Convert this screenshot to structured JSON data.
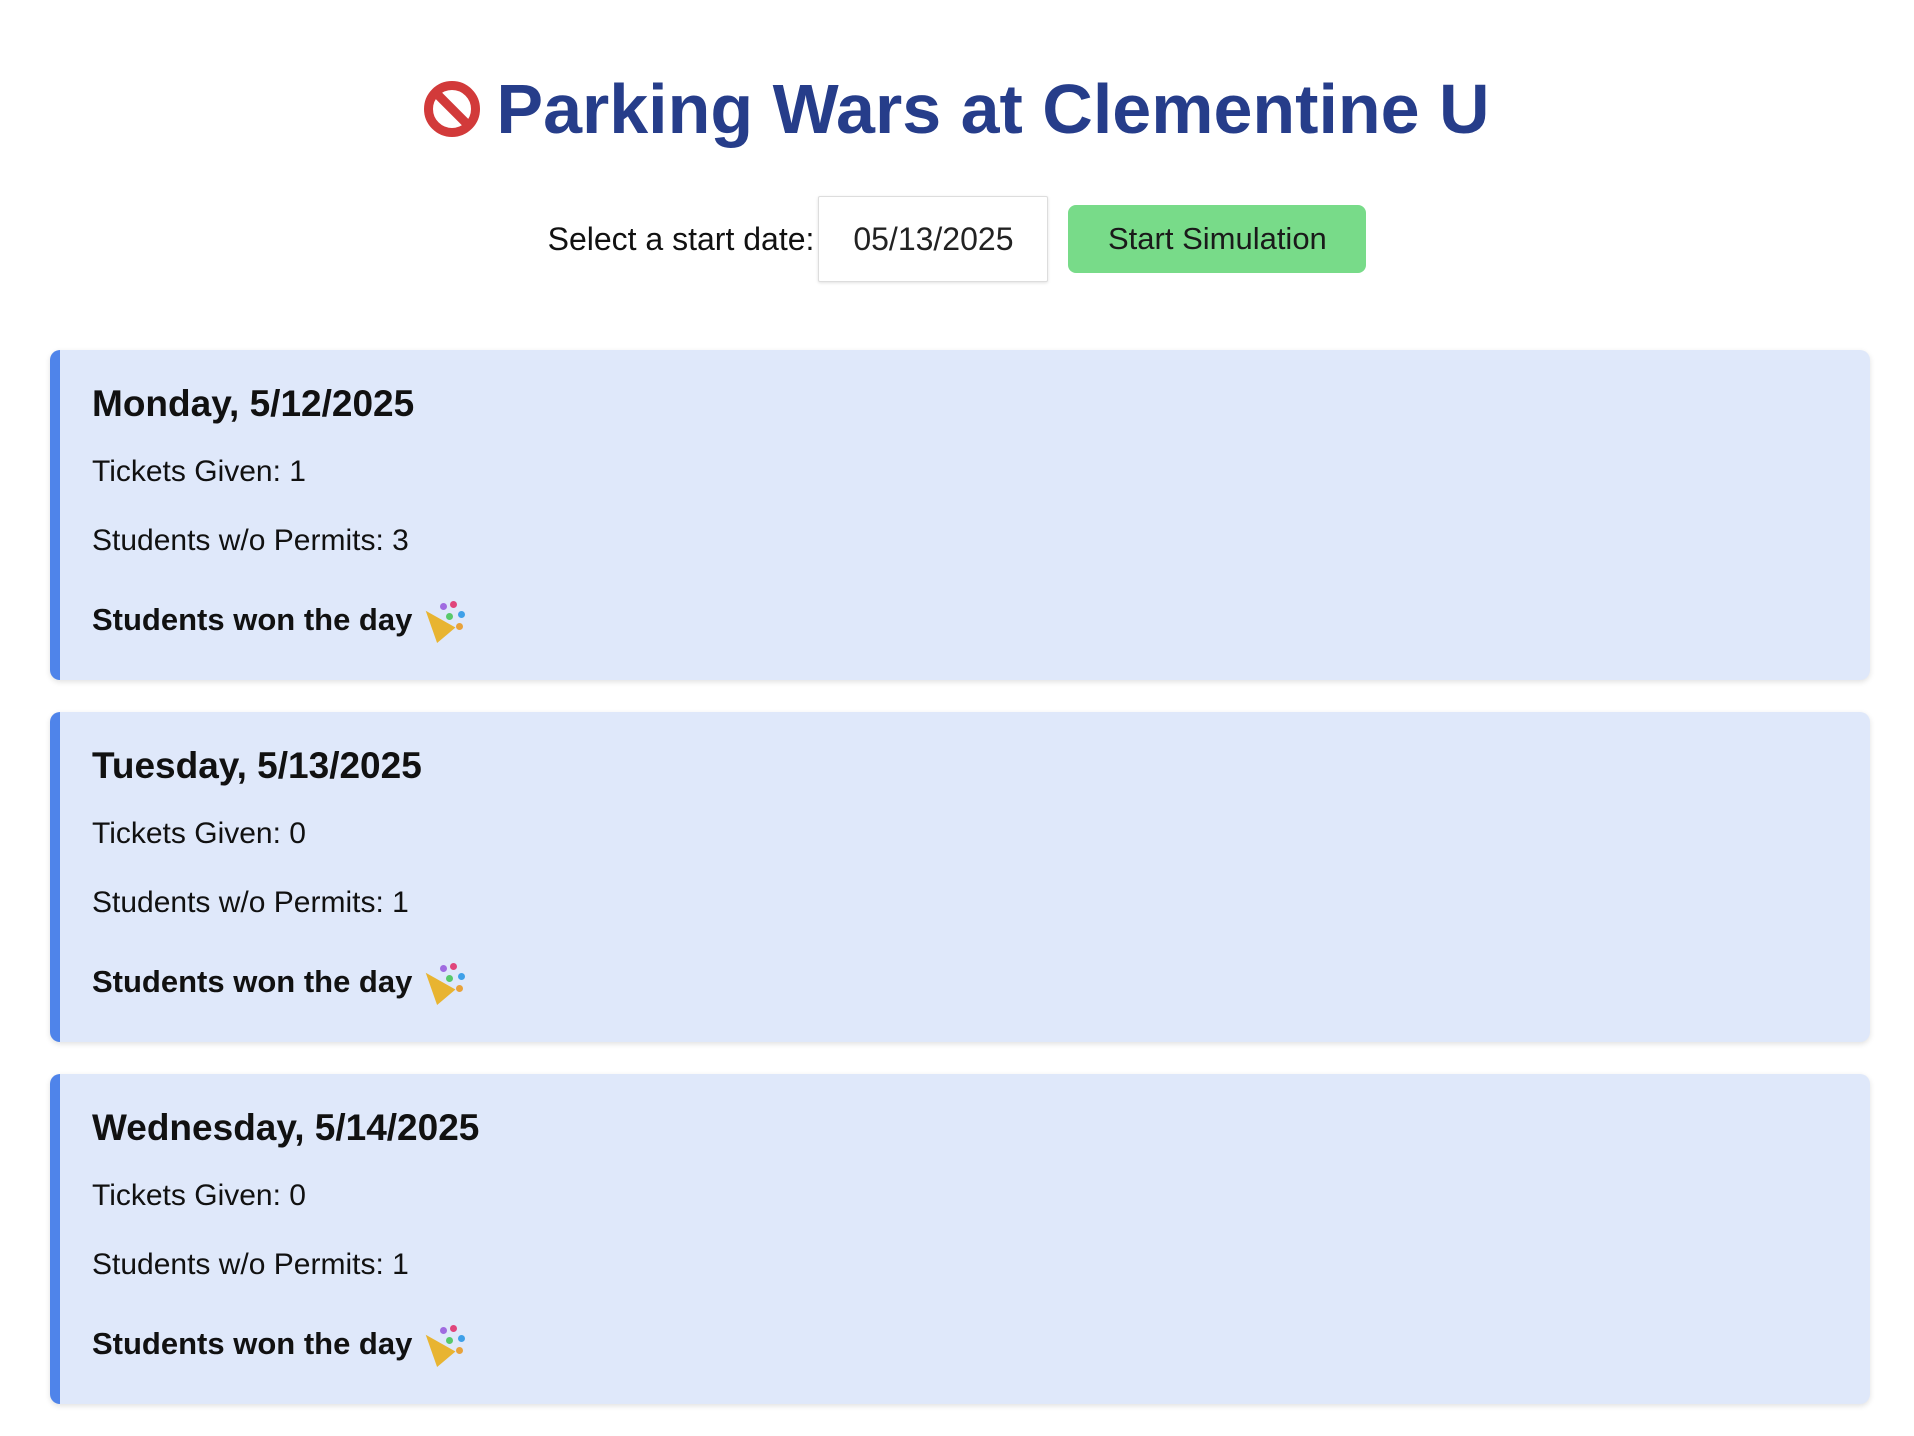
{
  "header": {
    "title": "Parking Wars at Clementine U",
    "title_icon": "no-entry-icon"
  },
  "controls": {
    "date_label": "Select a start date:",
    "date_value": "05/13/2025",
    "start_button_label": "Start Simulation"
  },
  "days": [
    {
      "title": "Monday, 5/12/2025",
      "tickets": "Tickets Given: 1",
      "permits": "Students w/o Permits: 3",
      "outcome": "Students won the day",
      "outcome_icon": "party-popper-icon"
    },
    {
      "title": "Tuesday, 5/13/2025",
      "tickets": "Tickets Given: 0",
      "permits": "Students w/o Permits: 1",
      "outcome": "Students won the day",
      "outcome_icon": "party-popper-icon"
    },
    {
      "title": "Wednesday, 5/14/2025",
      "tickets": "Tickets Given: 0",
      "permits": "Students w/o Permits: 1",
      "outcome": "Students won the day",
      "outcome_icon": "party-popper-icon"
    }
  ],
  "colors": {
    "title": "#263d8a",
    "card_background": "#dfe8fa",
    "card_accent": "#4f84ea",
    "button_background": "#78db89"
  }
}
